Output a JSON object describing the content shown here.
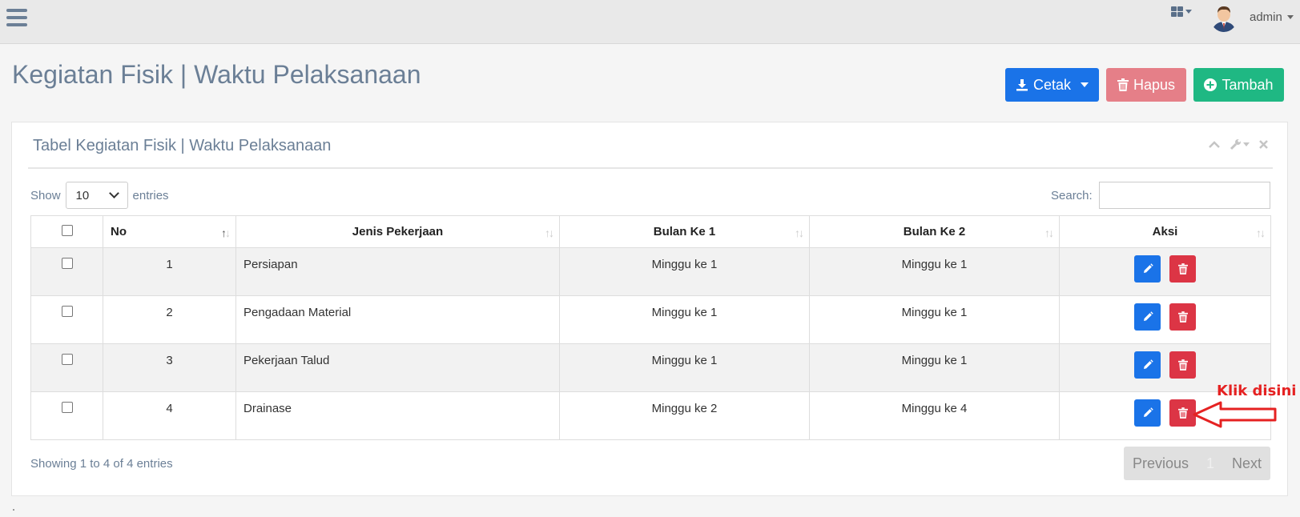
{
  "navbar": {
    "user_name": "admin"
  },
  "header": {
    "title": "Kegiatan Fisik | Waktu Pelaksanaan",
    "buttons": {
      "print": "Cetak",
      "delete": "Hapus",
      "add": "Tambah"
    }
  },
  "card": {
    "title": "Tabel Kegiatan Fisik | Waktu Pelaksanaan",
    "show_label": "Show",
    "page_length": "10",
    "entries_label": "entries",
    "search_label": "Search:",
    "search_value": ""
  },
  "table": {
    "columns": [
      "No",
      "Jenis Pekerjaan",
      "Bulan Ke 1",
      "Bulan Ke 2",
      "Aksi"
    ],
    "rows": [
      {
        "no": "1",
        "jenis": "Persiapan",
        "bulan1": "Minggu ke 1",
        "bulan2": "Minggu ke 1"
      },
      {
        "no": "2",
        "jenis": "Pengadaan Material",
        "bulan1": "Minggu ke 1",
        "bulan2": "Minggu ke 1"
      },
      {
        "no": "3",
        "jenis": "Pekerjaan Talud",
        "bulan1": "Minggu ke 1",
        "bulan2": "Minggu ke 1"
      },
      {
        "no": "4",
        "jenis": "Drainase",
        "bulan1": "Minggu ke 2",
        "bulan2": "Minggu ke 4"
      }
    ]
  },
  "footer": {
    "info": "Showing 1 to 4 of 4 entries",
    "previous": "Previous",
    "current_page": "1",
    "next": "Next"
  },
  "annotation": {
    "text": "Klik disini",
    "color": "#e52222"
  },
  "colors": {
    "primary": "#1a73e8",
    "danger": "#dc3545",
    "success": "#1fb883",
    "danger_light": "#e57f88",
    "title": "#6b7f96"
  }
}
